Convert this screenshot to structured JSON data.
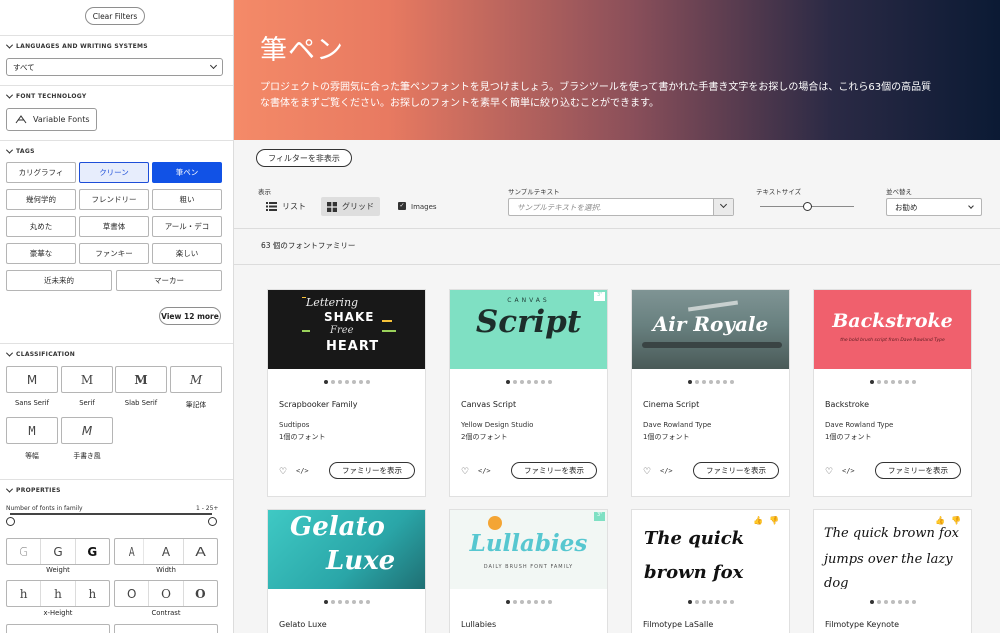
{
  "sidebar": {
    "clear_filters": "Clear Filters",
    "languages": {
      "title": "LANGUAGES AND WRITING SYSTEMS",
      "selected": "すべて"
    },
    "font_technology": {
      "title": "FONT TECHNOLOGY",
      "variable_fonts": "Variable Fonts"
    },
    "tags": {
      "title": "TAGS",
      "items": [
        "カリグラフィ",
        "クリーン",
        "筆ペン",
        "幾何学的",
        "フレンドリー",
        "粗い",
        "丸めた",
        "草書体",
        "アール・デコ",
        "豪華な",
        "ファンキー",
        "楽しい",
        "近未来的",
        "マーカー"
      ],
      "view_more": "View 12 more"
    },
    "classification": {
      "title": "CLASSIFICATION",
      "items": [
        {
          "glyph": "M",
          "label": "Sans Serif"
        },
        {
          "glyph": "M",
          "label": "Serif"
        },
        {
          "glyph": "M",
          "label": "Slab Serif"
        },
        {
          "glyph": "M",
          "label": "筆記体"
        },
        {
          "glyph": "M",
          "label": "等幅"
        },
        {
          "glyph": "M",
          "label": "手書き風"
        }
      ]
    },
    "properties": {
      "title": "PROPERTIES",
      "fonts_in_family": "Number of fonts in family",
      "range": "1 - 25+",
      "weight": {
        "label": "Weight",
        "glyphs": [
          "G",
          "G",
          "G"
        ]
      },
      "width": {
        "label": "Width",
        "glyphs": [
          "A",
          "A",
          "A"
        ]
      },
      "xheight": {
        "label": "x-Height",
        "glyphs": [
          "h",
          "h",
          "h"
        ]
      },
      "contrast": {
        "label": "Contrast",
        "glyphs": [
          "O",
          "O",
          "O"
        ]
      }
    }
  },
  "hero": {
    "title": "筆ペン",
    "description": "プロジェクトの雰囲気に合った筆ペンフォントを見つけましょう。ブラシツールを使って書かれた手書き文字をお探しの場合は、これら63個の高品質な書体をまずご覧ください。お探しのフォントを素早く簡単に絞り込むことができます。"
  },
  "toolbar": {
    "hide_filters": "フィルターを非表示",
    "display_label": "表示",
    "list_label": "リスト",
    "grid_label": "グリッド",
    "images_label": "Images",
    "sample_label": "サンプルテキスト",
    "sample_placeholder": "サンプルテキストを選択.",
    "text_size_label": "テキストサイズ",
    "sort_label": "並べ替え",
    "sort_value": "お勧め",
    "count": "63 個のフォントファミリー"
  },
  "cards": [
    {
      "name": "Scrapbooker Family",
      "foundry": "Sudtipos",
      "count": "1個のフォント",
      "button": "ファミリーを表示",
      "preview": [
        "Lettering",
        "SHAKE",
        "Free",
        "HEART"
      ]
    },
    {
      "name": "Canvas Script",
      "foundry": "Yellow Design Studio",
      "count": "2個のフォント",
      "button": "ファミリーを表示",
      "preview": [
        "CANVAS",
        "Script"
      ]
    },
    {
      "name": "Cinema Script",
      "foundry": "Dave Rowland Type",
      "count": "1個のフォント",
      "button": "ファミリーを表示",
      "preview": [
        "Air Royale"
      ]
    },
    {
      "name": "Backstroke",
      "foundry": "Dave Rowland Type",
      "count": "1個のフォント",
      "button": "ファミリーを表示",
      "preview": [
        "Backstroke",
        "the bold brush script from Dave Rowland Type"
      ]
    },
    {
      "name": "Gelato Luxe",
      "preview": [
        "Gelato",
        "Luxe"
      ]
    },
    {
      "name": "Lullabies",
      "preview": [
        "Lullabies",
        "DAILY BRUSH FONT FAMILY"
      ]
    },
    {
      "name": "Filmotype LaSalle",
      "preview": [
        "The quick",
        "brown fox"
      ]
    },
    {
      "name": "Filmotype Keynote",
      "preview": [
        "The quick brown fox",
        "jumps over the lazy",
        "dog"
      ]
    }
  ],
  "colors": {
    "accent": "#1152e6",
    "hero_start": "#f48a68",
    "hero_end": "#0b1a34"
  }
}
